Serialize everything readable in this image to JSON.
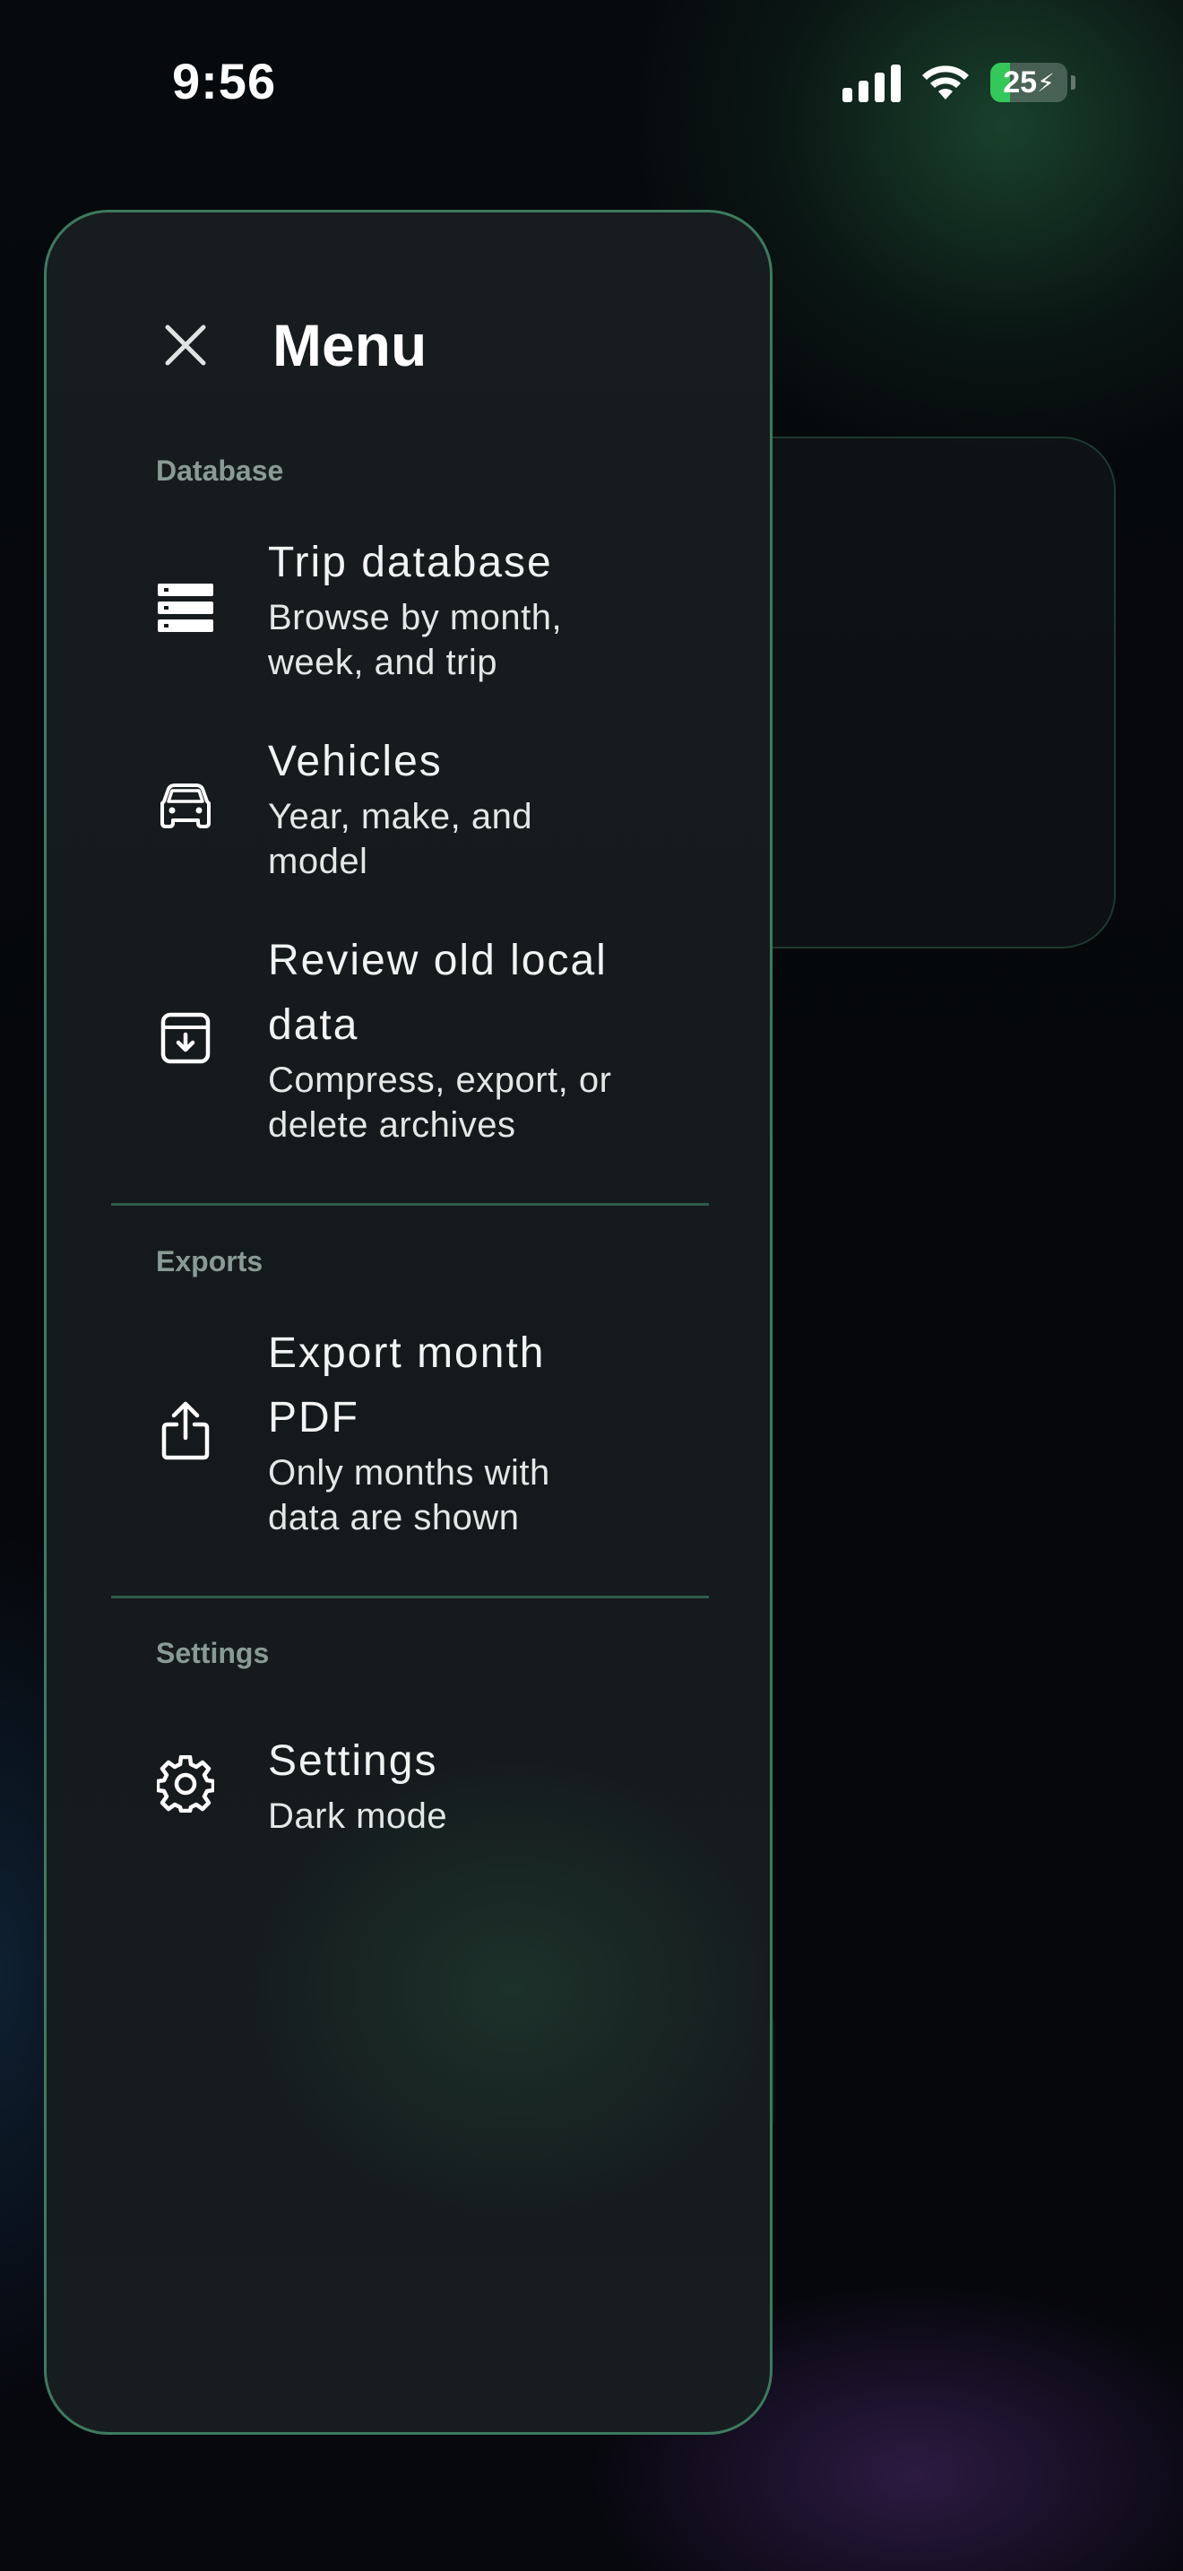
{
  "status_bar": {
    "time": "9:56",
    "battery_percent": "25"
  },
  "menu": {
    "title": "Menu",
    "sections": [
      {
        "label": "Database",
        "items": [
          {
            "icon": "database-rows-icon",
            "title_lines": [
              "Trip database"
            ],
            "subtitle_lines": [
              "Browse by month,",
              "week, and trip"
            ]
          },
          {
            "icon": "car-icon",
            "title_lines": [
              "Vehicles"
            ],
            "subtitle_lines": [
              "Year, make, and",
              "model"
            ]
          },
          {
            "icon": "archive-box-icon",
            "title_lines": [
              "Review old local",
              "data"
            ],
            "subtitle_lines": [
              "Compress, export, or",
              "delete archives"
            ]
          }
        ]
      },
      {
        "label": "Exports",
        "items": [
          {
            "icon": "share-upload-icon",
            "title_lines": [
              "Export month",
              "PDF"
            ],
            "subtitle_lines": [
              "Only months with",
              "data are shown"
            ]
          }
        ]
      },
      {
        "label": "Settings",
        "items": [
          {
            "icon": "gear-icon",
            "title_lines": [
              "Settings"
            ],
            "subtitle_lines": [
              "Dark mode"
            ]
          }
        ]
      }
    ]
  },
  "colors": {
    "drawer_border": "#3c7a5e",
    "divider": "#2f5c4a",
    "section_label": "#8a9a94",
    "battery_fill": "#34c759"
  }
}
